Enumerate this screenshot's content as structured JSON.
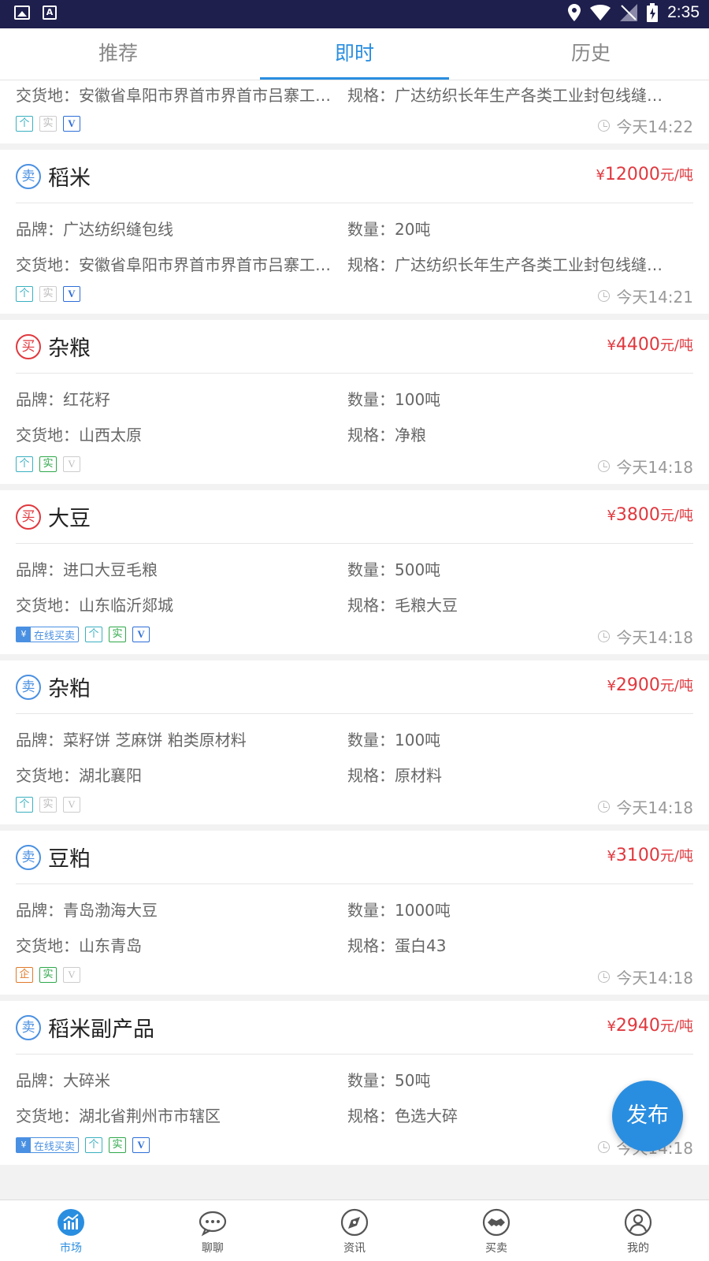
{
  "status_bar": {
    "time": "2:35"
  },
  "tabs": [
    {
      "label": "推荐"
    },
    {
      "label": "即时"
    },
    {
      "label": "历史"
    }
  ],
  "labels": {
    "brand": "品牌：",
    "qty": "数量：",
    "place": "交货地：",
    "spec": "规格："
  },
  "listings": [
    {
      "partial": true,
      "place": "安徽省阜阳市界首市界首市吕寨工业园区",
      "spec": "广达纺织长年生产各类工业封包线缝包线",
      "tags": [
        "ge",
        "shi-off",
        "v-on"
      ],
      "online": false,
      "time": "今天14:22"
    },
    {
      "type": "sell",
      "badge": "卖",
      "name": "稻米",
      "price_symbol": "¥",
      "price": "12000",
      "unit": "元/吨",
      "brand": "广达纺织缝包线",
      "qty": "20吨",
      "place": "安徽省阜阳市界首市界首市吕寨工业园区",
      "spec": "广达纺织长年生产各类工业封包线缝包线",
      "tags": [
        "ge",
        "shi-off",
        "v-on"
      ],
      "online": false,
      "time": "今天14:21"
    },
    {
      "type": "buy",
      "badge": "买",
      "name": "杂粮",
      "price_symbol": "¥",
      "price": "4400",
      "unit": "元/吨",
      "brand": "红花籽",
      "qty": "100吨",
      "place": "山西太原",
      "spec": "净粮",
      "tags": [
        "ge",
        "shi-on",
        "v-off"
      ],
      "online": false,
      "time": "今天14:18"
    },
    {
      "type": "buy",
      "badge": "买",
      "name": "大豆",
      "price_symbol": "¥",
      "price": "3800",
      "unit": "元/吨",
      "brand": "进口大豆毛粮",
      "qty": "500吨",
      "place": "山东临沂郯城",
      "spec": "毛粮大豆",
      "tags": [
        "ge",
        "shi-on",
        "v-on"
      ],
      "online": true,
      "online_label": "在线买卖",
      "time": "今天14:18"
    },
    {
      "type": "sell",
      "badge": "卖",
      "name": "杂粕",
      "price_symbol": "¥",
      "price": "2900",
      "unit": "元/吨",
      "brand": "菜籽饼 芝麻饼  粕类原材料",
      "qty": "100吨",
      "place": "湖北襄阳",
      "spec": "原材料",
      "tags": [
        "ge",
        "shi-off",
        "v-off"
      ],
      "online": false,
      "time": "今天14:18"
    },
    {
      "type": "sell",
      "badge": "卖",
      "name": "豆粕",
      "price_symbol": "¥",
      "price": "3100",
      "unit": "元/吨",
      "brand": "青岛渤海大豆",
      "qty": "1000吨",
      "place": "山东青岛",
      "spec": "蛋白43",
      "tags": [
        "qi",
        "shi-on",
        "v-off"
      ],
      "online": false,
      "time": "今天14:18"
    },
    {
      "type": "sell",
      "badge": "卖",
      "name": "稻米副产品",
      "price_symbol": "¥",
      "price": "2940",
      "unit": "元/吨",
      "brand": "大碎米",
      "qty": "50吨",
      "place": "湖北省荆州市市辖区",
      "spec": "色选大碎",
      "tags": [
        "ge",
        "shi-on",
        "v-on"
      ],
      "online": true,
      "online_label": "在线买卖",
      "time": "今天14:18"
    }
  ],
  "tag_text": {
    "ge": "个",
    "qi": "企",
    "shi": "实",
    "v": "V"
  },
  "fab": {
    "label": "发布"
  },
  "bottom_nav": [
    {
      "label": "市场",
      "icon": "market-chart-icon",
      "active": true
    },
    {
      "label": "聊聊",
      "icon": "chat-icon",
      "active": false
    },
    {
      "label": "资讯",
      "icon": "compass-icon",
      "active": false
    },
    {
      "label": "买卖",
      "icon": "handshake-icon",
      "active": false
    },
    {
      "label": "我的",
      "icon": "profile-icon",
      "active": false
    }
  ],
  "colors": {
    "accent": "#2a8ee0",
    "price": "#e0383e",
    "statusbar": "#1e1f4d"
  }
}
